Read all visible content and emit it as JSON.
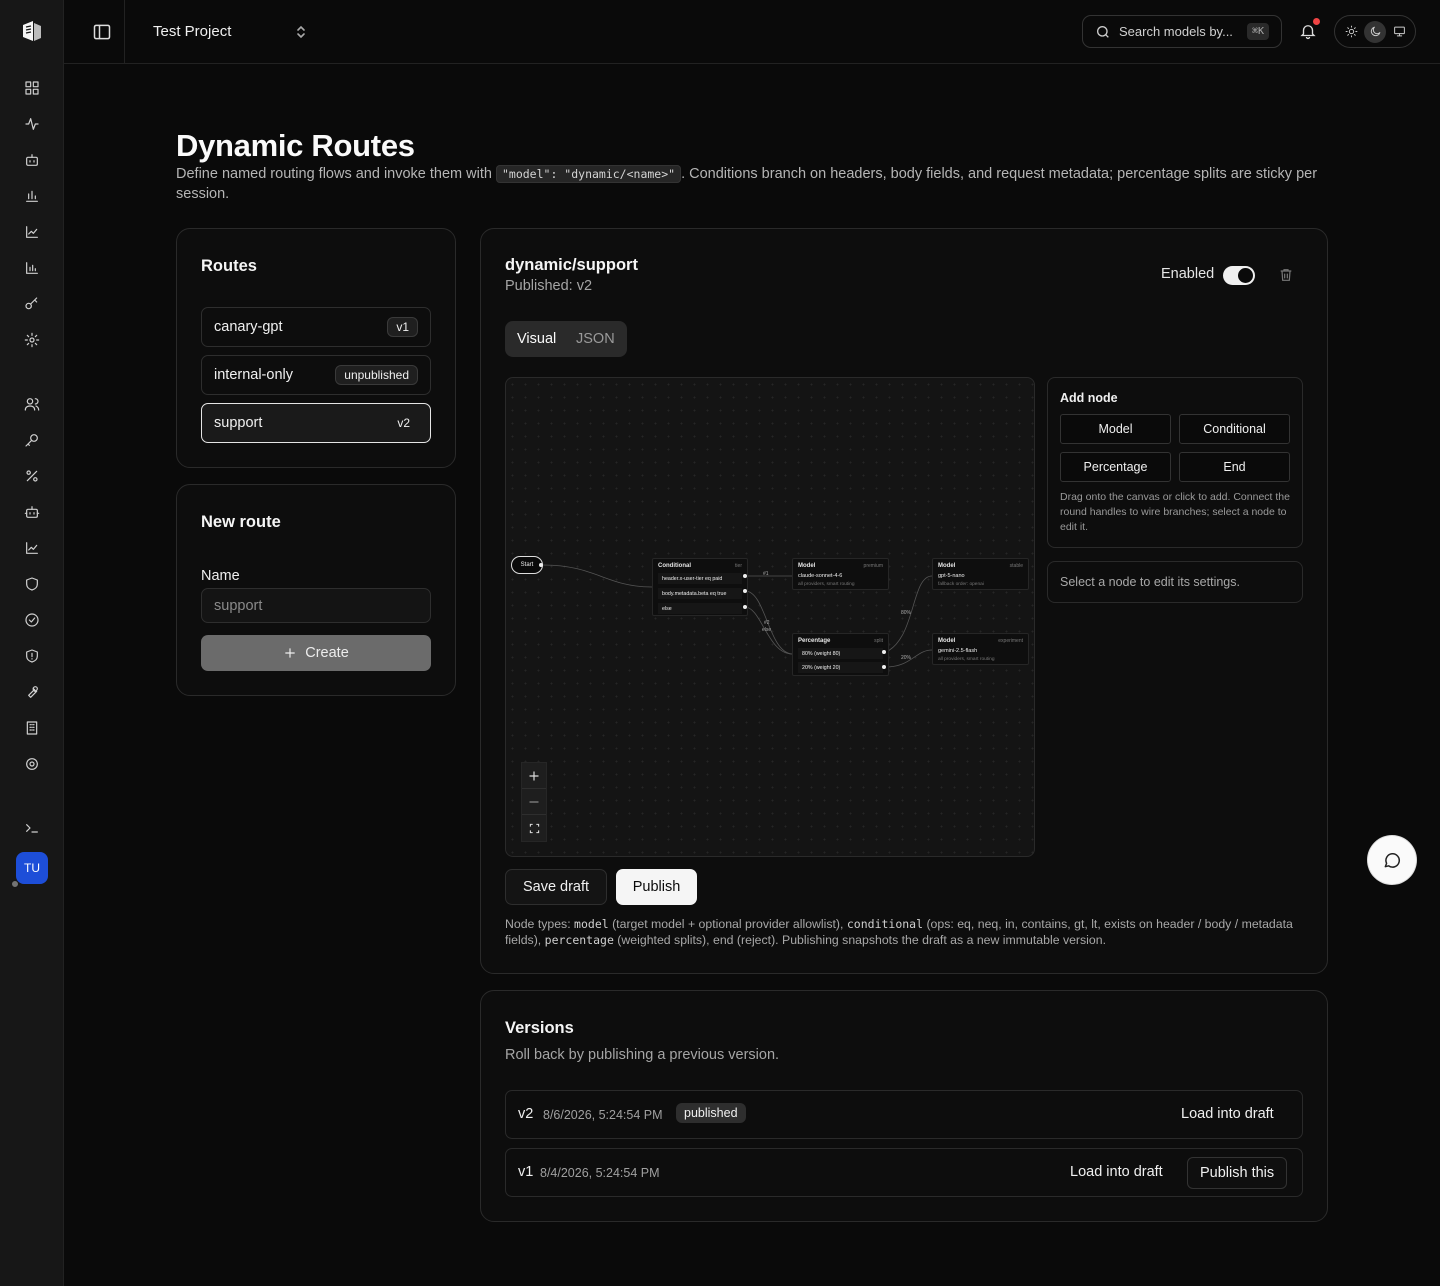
{
  "topbar": {
    "project": "Test Project",
    "search_placeholder": "Search models by...",
    "search_shortcut": "⌘K"
  },
  "user": {
    "initials": "TU"
  },
  "page": {
    "title": "Dynamic Routes",
    "desc_pre": "Define named routing flows and invoke them with ",
    "desc_code": "\"model\": \"dynamic/<name>\"",
    "desc_post": ". Conditions branch on headers, body fields, and request metadata; percentage splits are sticky per session."
  },
  "routes_card": {
    "title": "Routes",
    "items": [
      {
        "name": "canary-gpt",
        "badge": "v1"
      },
      {
        "name": "internal-only",
        "badge": "unpublished"
      },
      {
        "name": "support",
        "badge": "v2"
      }
    ]
  },
  "new_route": {
    "title": "New route",
    "name_label": "Name",
    "name_value": "support",
    "create_label": "Create"
  },
  "editor": {
    "route_name": "dynamic/support",
    "published": "Published: v2",
    "enabled_label": "Enabled",
    "enabled": true,
    "tabs": [
      "Visual",
      "JSON"
    ],
    "active_tab": "Visual",
    "add_node": {
      "title": "Add node",
      "buttons": [
        "Model",
        "Conditional",
        "Percentage",
        "End"
      ],
      "help": "Drag onto the canvas or click to add. Connect the round handles to wire branches; select a node to edit it."
    },
    "select_hint": "Select a node to edit its settings.",
    "save_draft": "Save draft",
    "publish": "Publish",
    "note": {
      "t1": "Node types: ",
      "c1": "model",
      "t2": " (target model + optional provider allowlist), ",
      "c2": "conditional",
      "t3": " (ops: eq, neq, in, contains, gt, lt, exists on header / body / metadata fields), ",
      "c3": "percentage",
      "t4": " (weighted splits), end (reject). Publishing snapshots the draft as a new immutable version."
    }
  },
  "flow": {
    "start": "Start",
    "conditional": {
      "title": "Conditional",
      "tag": "tier",
      "rows": [
        "header.x-user-tier eq paid",
        "body.metadata.beta eq true",
        "else"
      ]
    },
    "model_premium": {
      "title": "Model",
      "tag": "premium",
      "model": "claude-sonnet-4-6",
      "sub": "all providers, smart routing"
    },
    "model_stable": {
      "title": "Model",
      "tag": "stable",
      "model": "gpt-5-nano",
      "sub": "fallback order: openai"
    },
    "percentage": {
      "title": "Percentage",
      "tag": "split",
      "rows": [
        "80% (weight 80)",
        "20% (weight 20)"
      ]
    },
    "model_experiment": {
      "title": "Model",
      "tag": "experiment",
      "model": "gemini-2.5-flash",
      "sub": "all providers, smart routing"
    },
    "edge_labels": {
      "e1": "#1",
      "e2a": "#2",
      "e2b": "else",
      "p80": "80%",
      "p20": "20%"
    }
  },
  "versions": {
    "title": "Versions",
    "subtitle": "Roll back by publishing a previous version.",
    "items": [
      {
        "version": "v2",
        "date": "8/6/2026, 5:24:54 PM",
        "badge": "published",
        "action": "Load into draft"
      },
      {
        "version": "v1",
        "date": "8/4/2026, 5:24:54 PM",
        "action": "Load into draft",
        "action2": "Publish this"
      }
    ]
  }
}
